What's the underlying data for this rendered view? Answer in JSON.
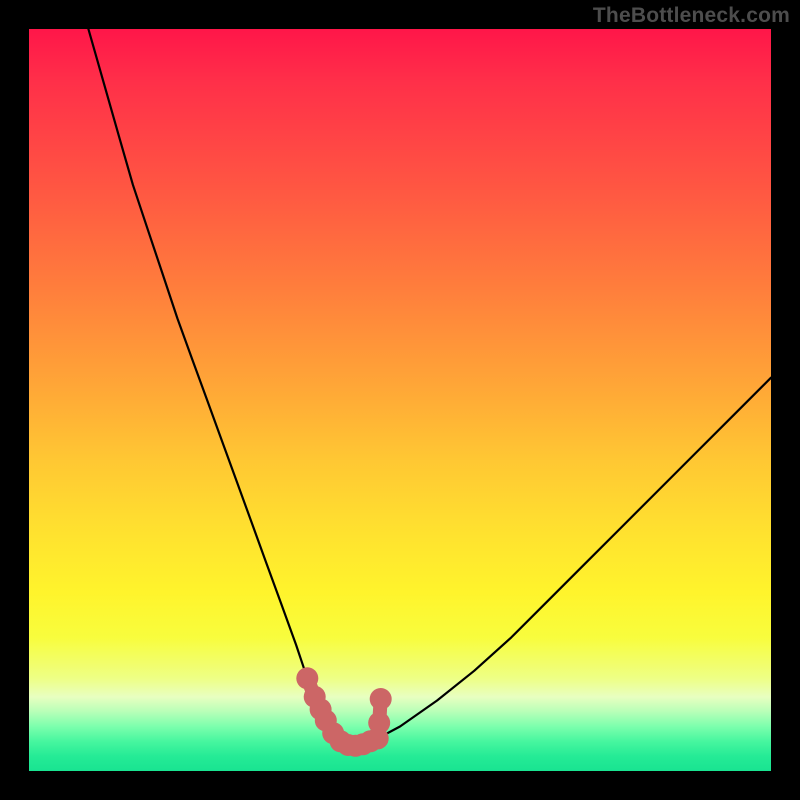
{
  "attribution": "TheBottleneck.com",
  "chart_data": {
    "type": "line",
    "title": "",
    "xlabel": "",
    "ylabel": "",
    "xlim": [
      0,
      100
    ],
    "ylim": [
      0,
      100
    ],
    "series": [
      {
        "name": "bottleneck-curve",
        "x": [
          8,
          10,
          12,
          14,
          16,
          18,
          20,
          22,
          24,
          26,
          28,
          30,
          32,
          34,
          36,
          37.5,
          39,
          40,
          41,
          42,
          43,
          44,
          45,
          47,
          50,
          55,
          60,
          65,
          70,
          75,
          80,
          85,
          90,
          95,
          100
        ],
        "values": [
          100,
          93,
          86,
          79,
          73,
          67,
          61,
          55.5,
          50,
          44.5,
          39,
          33.5,
          28,
          22.5,
          17,
          12.5,
          9,
          6.8,
          5.1,
          4,
          3.5,
          3.4,
          3.6,
          4.4,
          6,
          9.5,
          13.5,
          18,
          23,
          28,
          33,
          38,
          43,
          48,
          53
        ]
      }
    ],
    "markers": {
      "name": "valley-highlight",
      "color": "#cc6666",
      "points": [
        {
          "x": 37.5,
          "y": 12.5
        },
        {
          "x": 38.5,
          "y": 10
        },
        {
          "x": 39.3,
          "y": 8.3
        },
        {
          "x": 40.0,
          "y": 6.8
        },
        {
          "x": 41.0,
          "y": 5.1
        },
        {
          "x": 42.0,
          "y": 4.0
        },
        {
          "x": 43.0,
          "y": 3.5
        },
        {
          "x": 44.0,
          "y": 3.4
        },
        {
          "x": 45.0,
          "y": 3.6
        },
        {
          "x": 46.0,
          "y": 4.0
        },
        {
          "x": 47.0,
          "y": 4.4
        },
        {
          "x": 47.2,
          "y": 6.5
        },
        {
          "x": 47.4,
          "y": 9.7
        }
      ]
    }
  }
}
